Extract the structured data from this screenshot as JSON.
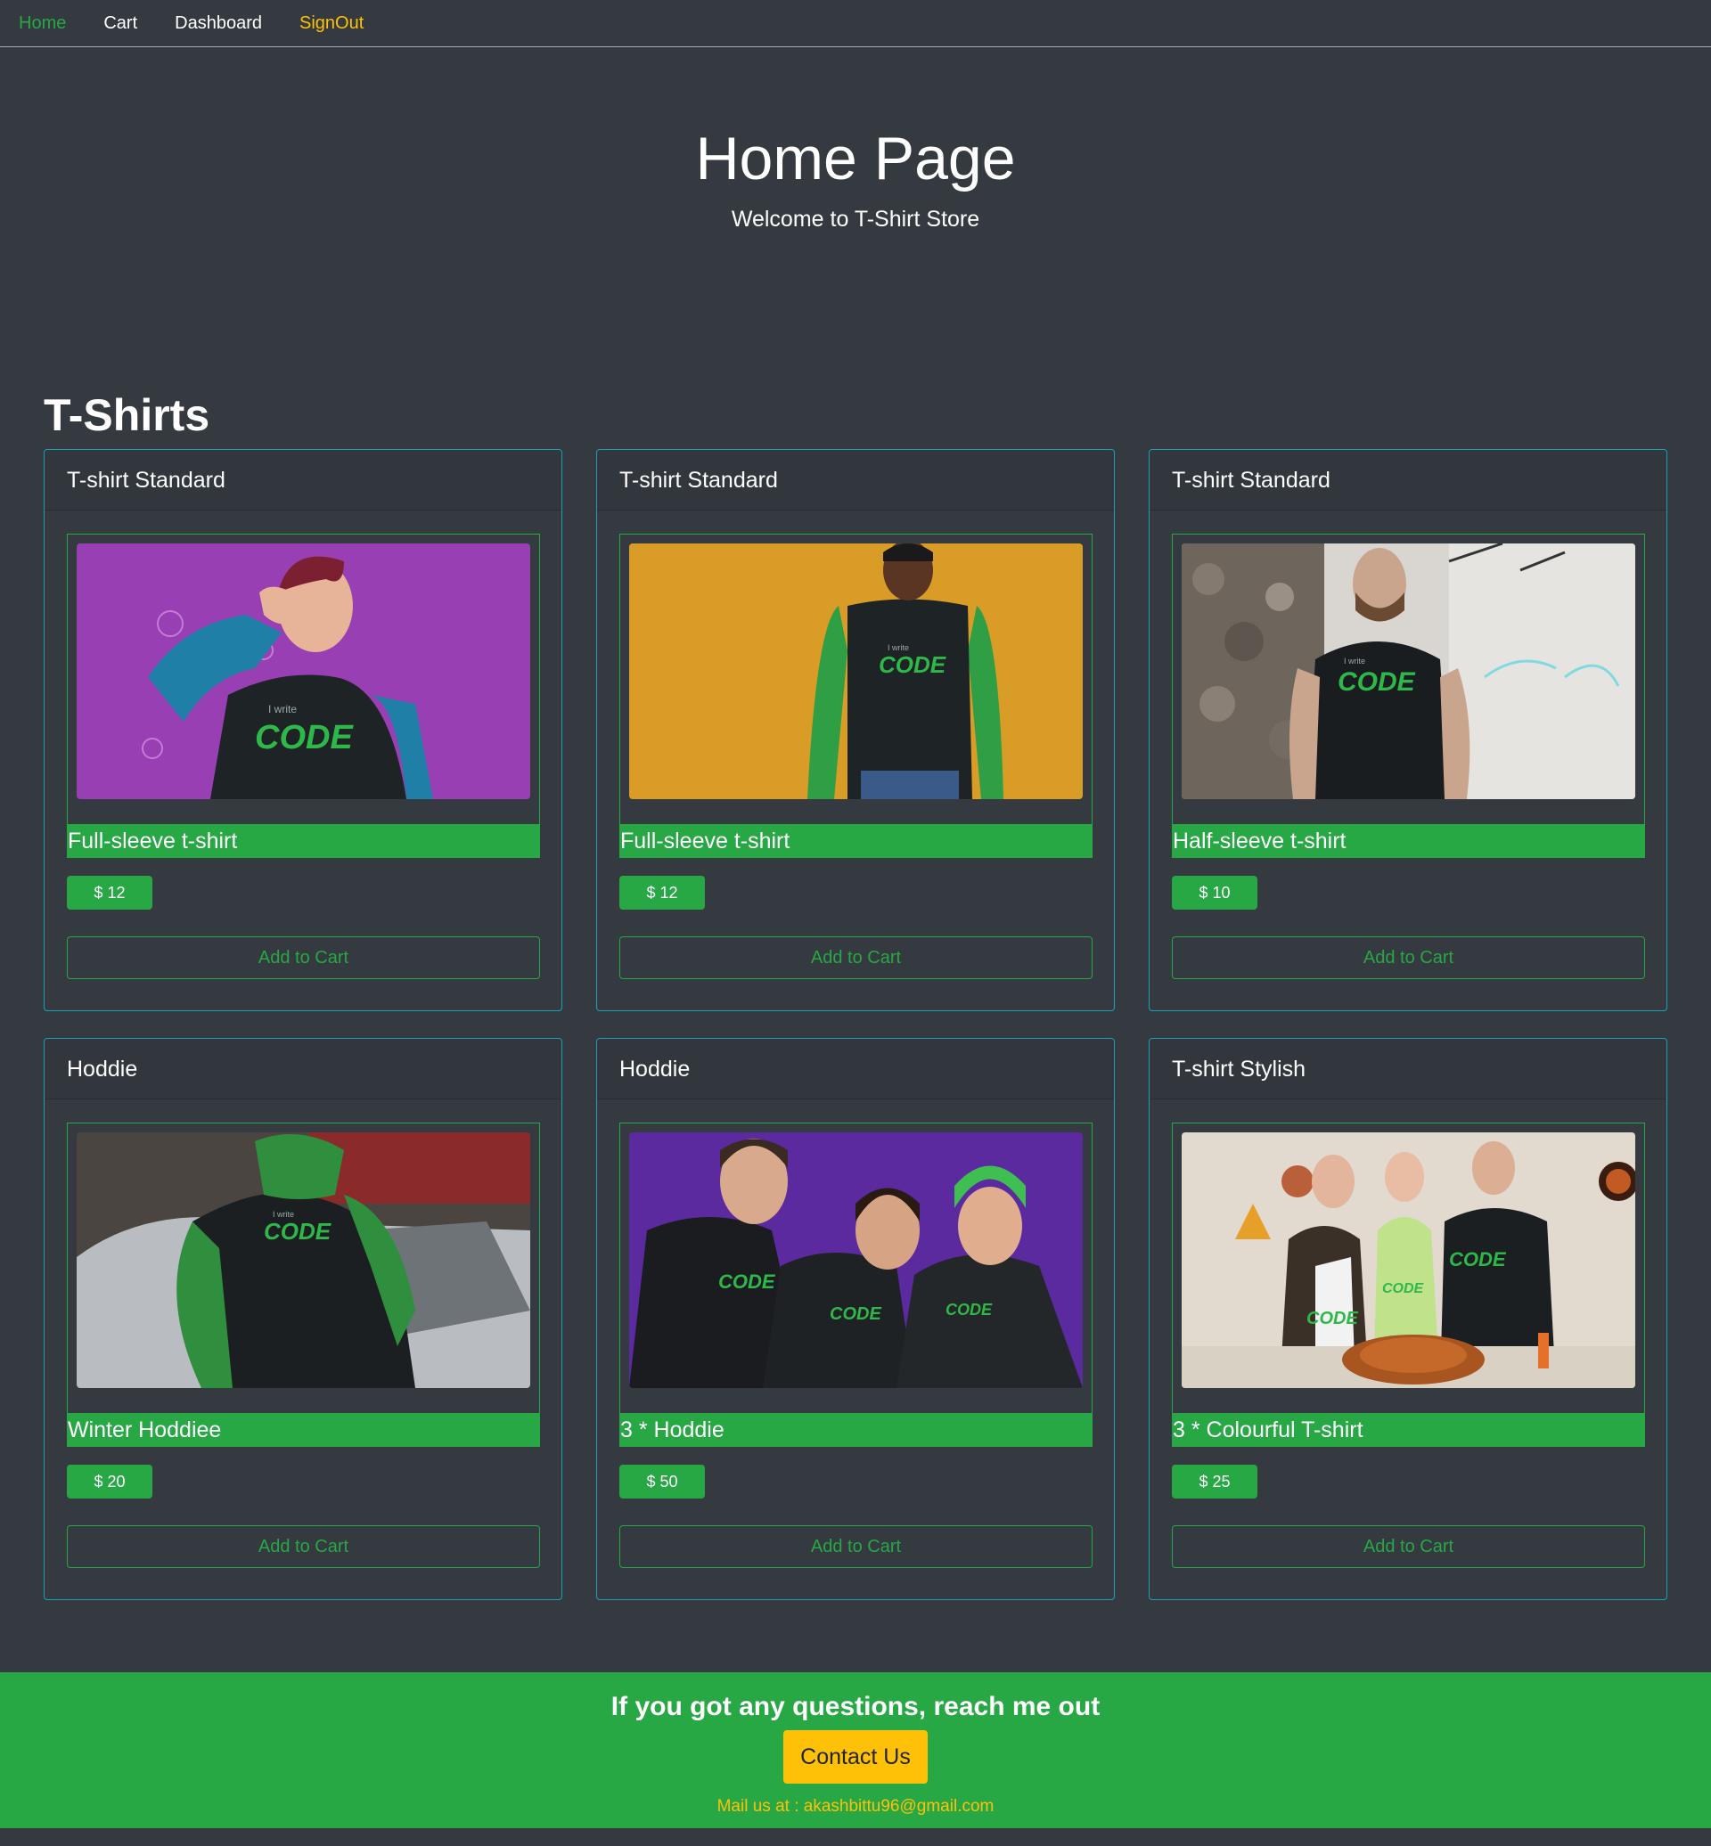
{
  "nav": {
    "home": "Home",
    "cart": "Cart",
    "dashboard": "Dashboard",
    "signout": "SignOut"
  },
  "hero": {
    "title": "Home Page",
    "subtitle": "Welcome to T-Shirt Store"
  },
  "section": {
    "title": "T-Shirts"
  },
  "products": [
    {
      "header": "T-shirt Standard",
      "name": "Full-sleeve t-shirt",
      "price": "$ 12",
      "button": "Add to Cart",
      "image": "woman-purple-backdrop-code-shirt"
    },
    {
      "header": "T-shirt Standard",
      "name": "Full-sleeve t-shirt",
      "price": "$ 12",
      "button": "Add to Cart",
      "image": "man-yellow-backdrop-code-shirt"
    },
    {
      "header": "T-shirt Standard",
      "name": "Half-sleeve t-shirt",
      "price": "$ 10",
      "button": "Add to Cart",
      "image": "man-stone-wall-code-shirt"
    },
    {
      "header": "Hoddie",
      "name": "Winter Hoddiee",
      "price": "$ 20",
      "button": "Add to Cart",
      "image": "person-car-green-hoodie"
    },
    {
      "header": "Hoddie",
      "name": "3 * Hoddie",
      "price": "$ 50",
      "button": "Add to Cart",
      "image": "three-people-hoodies-purple"
    },
    {
      "header": "T-shirt Stylish",
      "name": "3 * Colourful T-shirt",
      "price": "$ 25",
      "button": "Add to Cart",
      "image": "family-dinner-shirts"
    }
  ],
  "footer": {
    "heading": "If you got any questions, reach me out",
    "button": "Contact Us",
    "mail": "Mail us at : akashbittu96@gmail.com"
  },
  "colors": {
    "background": "#343a40",
    "success": "#28a745",
    "warning": "#ffc107",
    "info_border": "#17a2b8"
  }
}
